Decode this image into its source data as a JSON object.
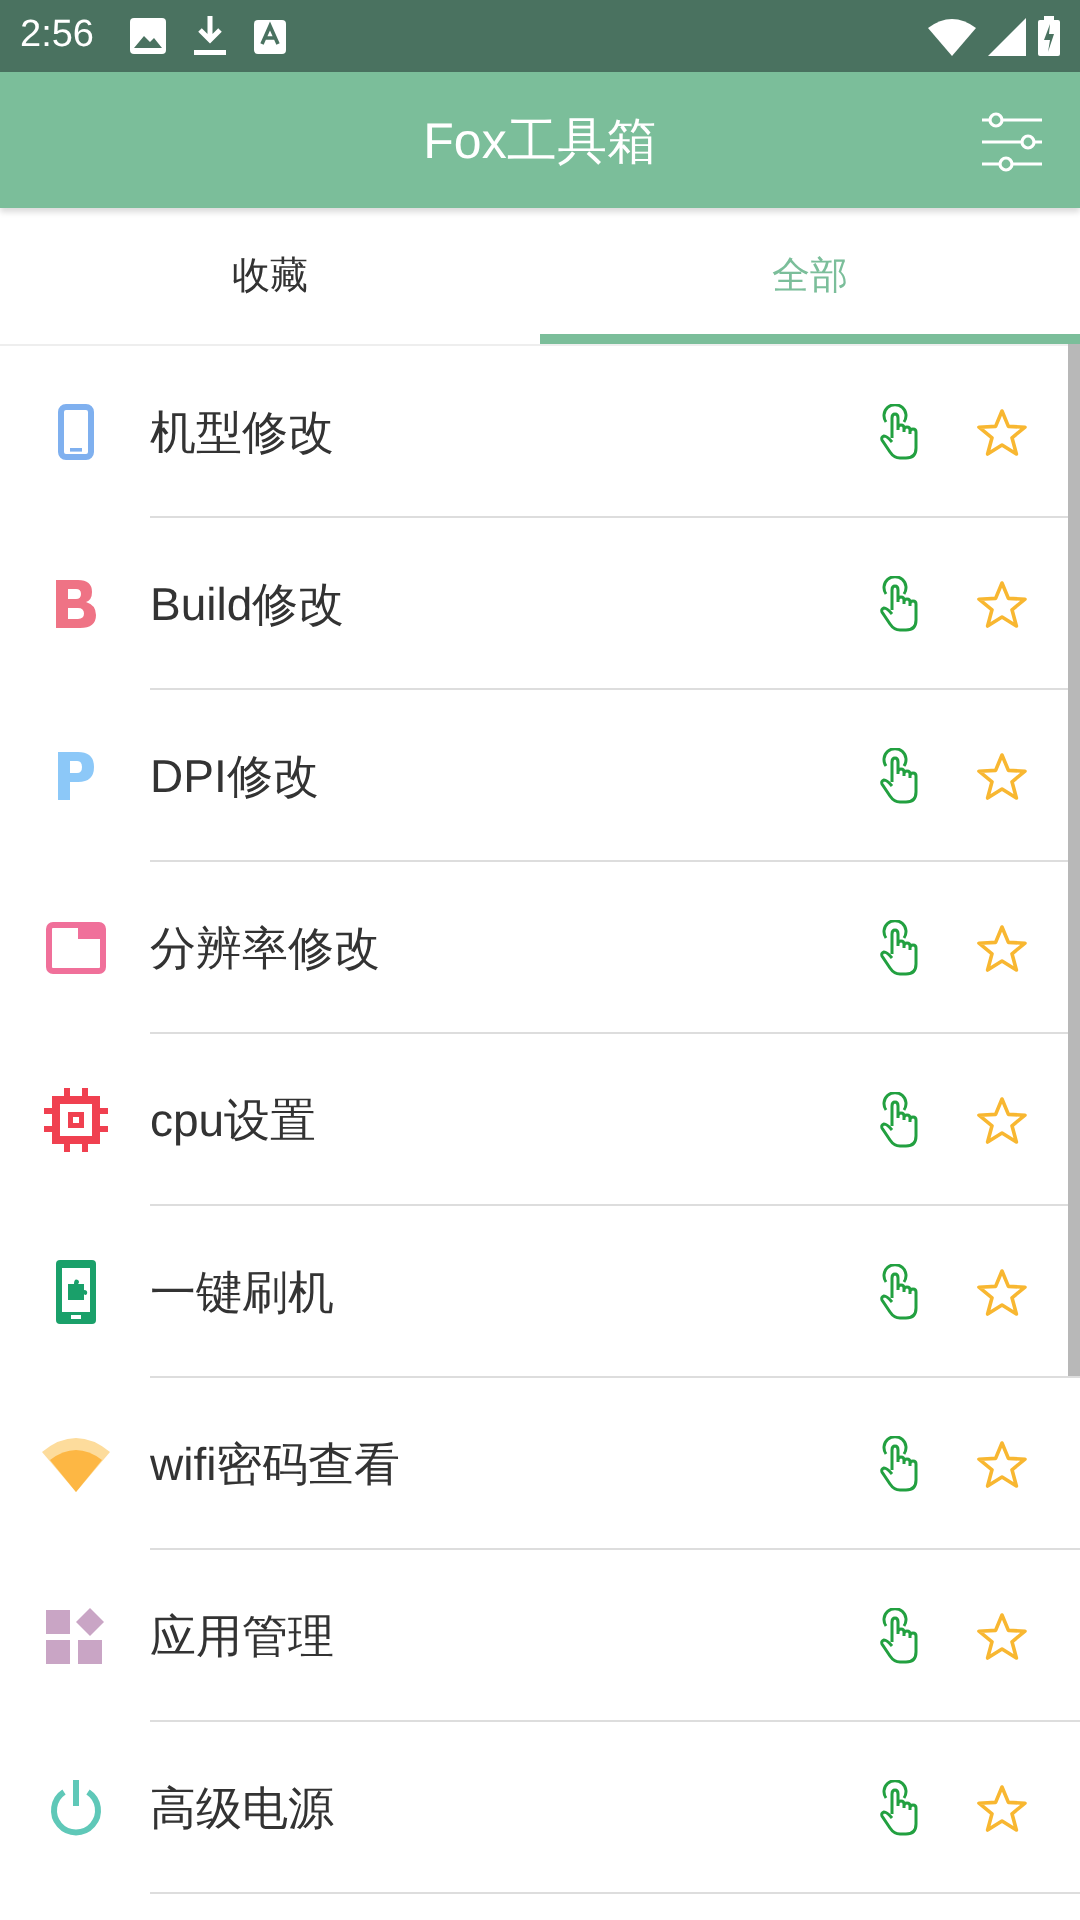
{
  "status_bar": {
    "time": "2:56"
  },
  "app_bar": {
    "title": "Fox工具箱"
  },
  "tabs": [
    {
      "label": "收藏",
      "selected": false
    },
    {
      "label": "全部",
      "selected": true
    }
  ],
  "tools": [
    {
      "name": "机型修改",
      "kind": "phone",
      "favorite": false
    },
    {
      "name": "Build修改",
      "kind": "letter-b",
      "favorite": false
    },
    {
      "name": "DPI修改",
      "kind": "letter-p",
      "favorite": false
    },
    {
      "name": "分辨率修改",
      "kind": "window",
      "favorite": false
    },
    {
      "name": "cpu设置",
      "kind": "chip",
      "favorite": false
    },
    {
      "name": "一键刷机",
      "kind": "puzzle-phone",
      "favorite": false
    },
    {
      "name": "wifi密码查看",
      "kind": "wifi",
      "favorite": false
    },
    {
      "name": "应用管理",
      "kind": "apps",
      "favorite": false
    },
    {
      "name": "高级电源",
      "kind": "power",
      "favorite": false
    }
  ]
}
